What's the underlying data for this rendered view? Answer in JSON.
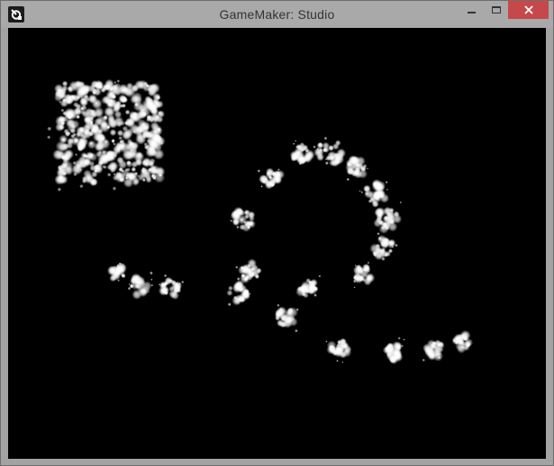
{
  "window": {
    "title": "GameMaker: Studio",
    "app_icon": "gamemaker-logo-icon",
    "controls": {
      "minimize_icon": "minimize-icon",
      "maximize_icon": "maximize-icon",
      "close_icon": "close-icon"
    }
  },
  "canvas": {
    "background": "#000000",
    "particle_color": "#ffffff"
  },
  "colors": {
    "titlebar": "#a9a9a9",
    "close_button": "#c7484a",
    "title_text": "#333333"
  }
}
